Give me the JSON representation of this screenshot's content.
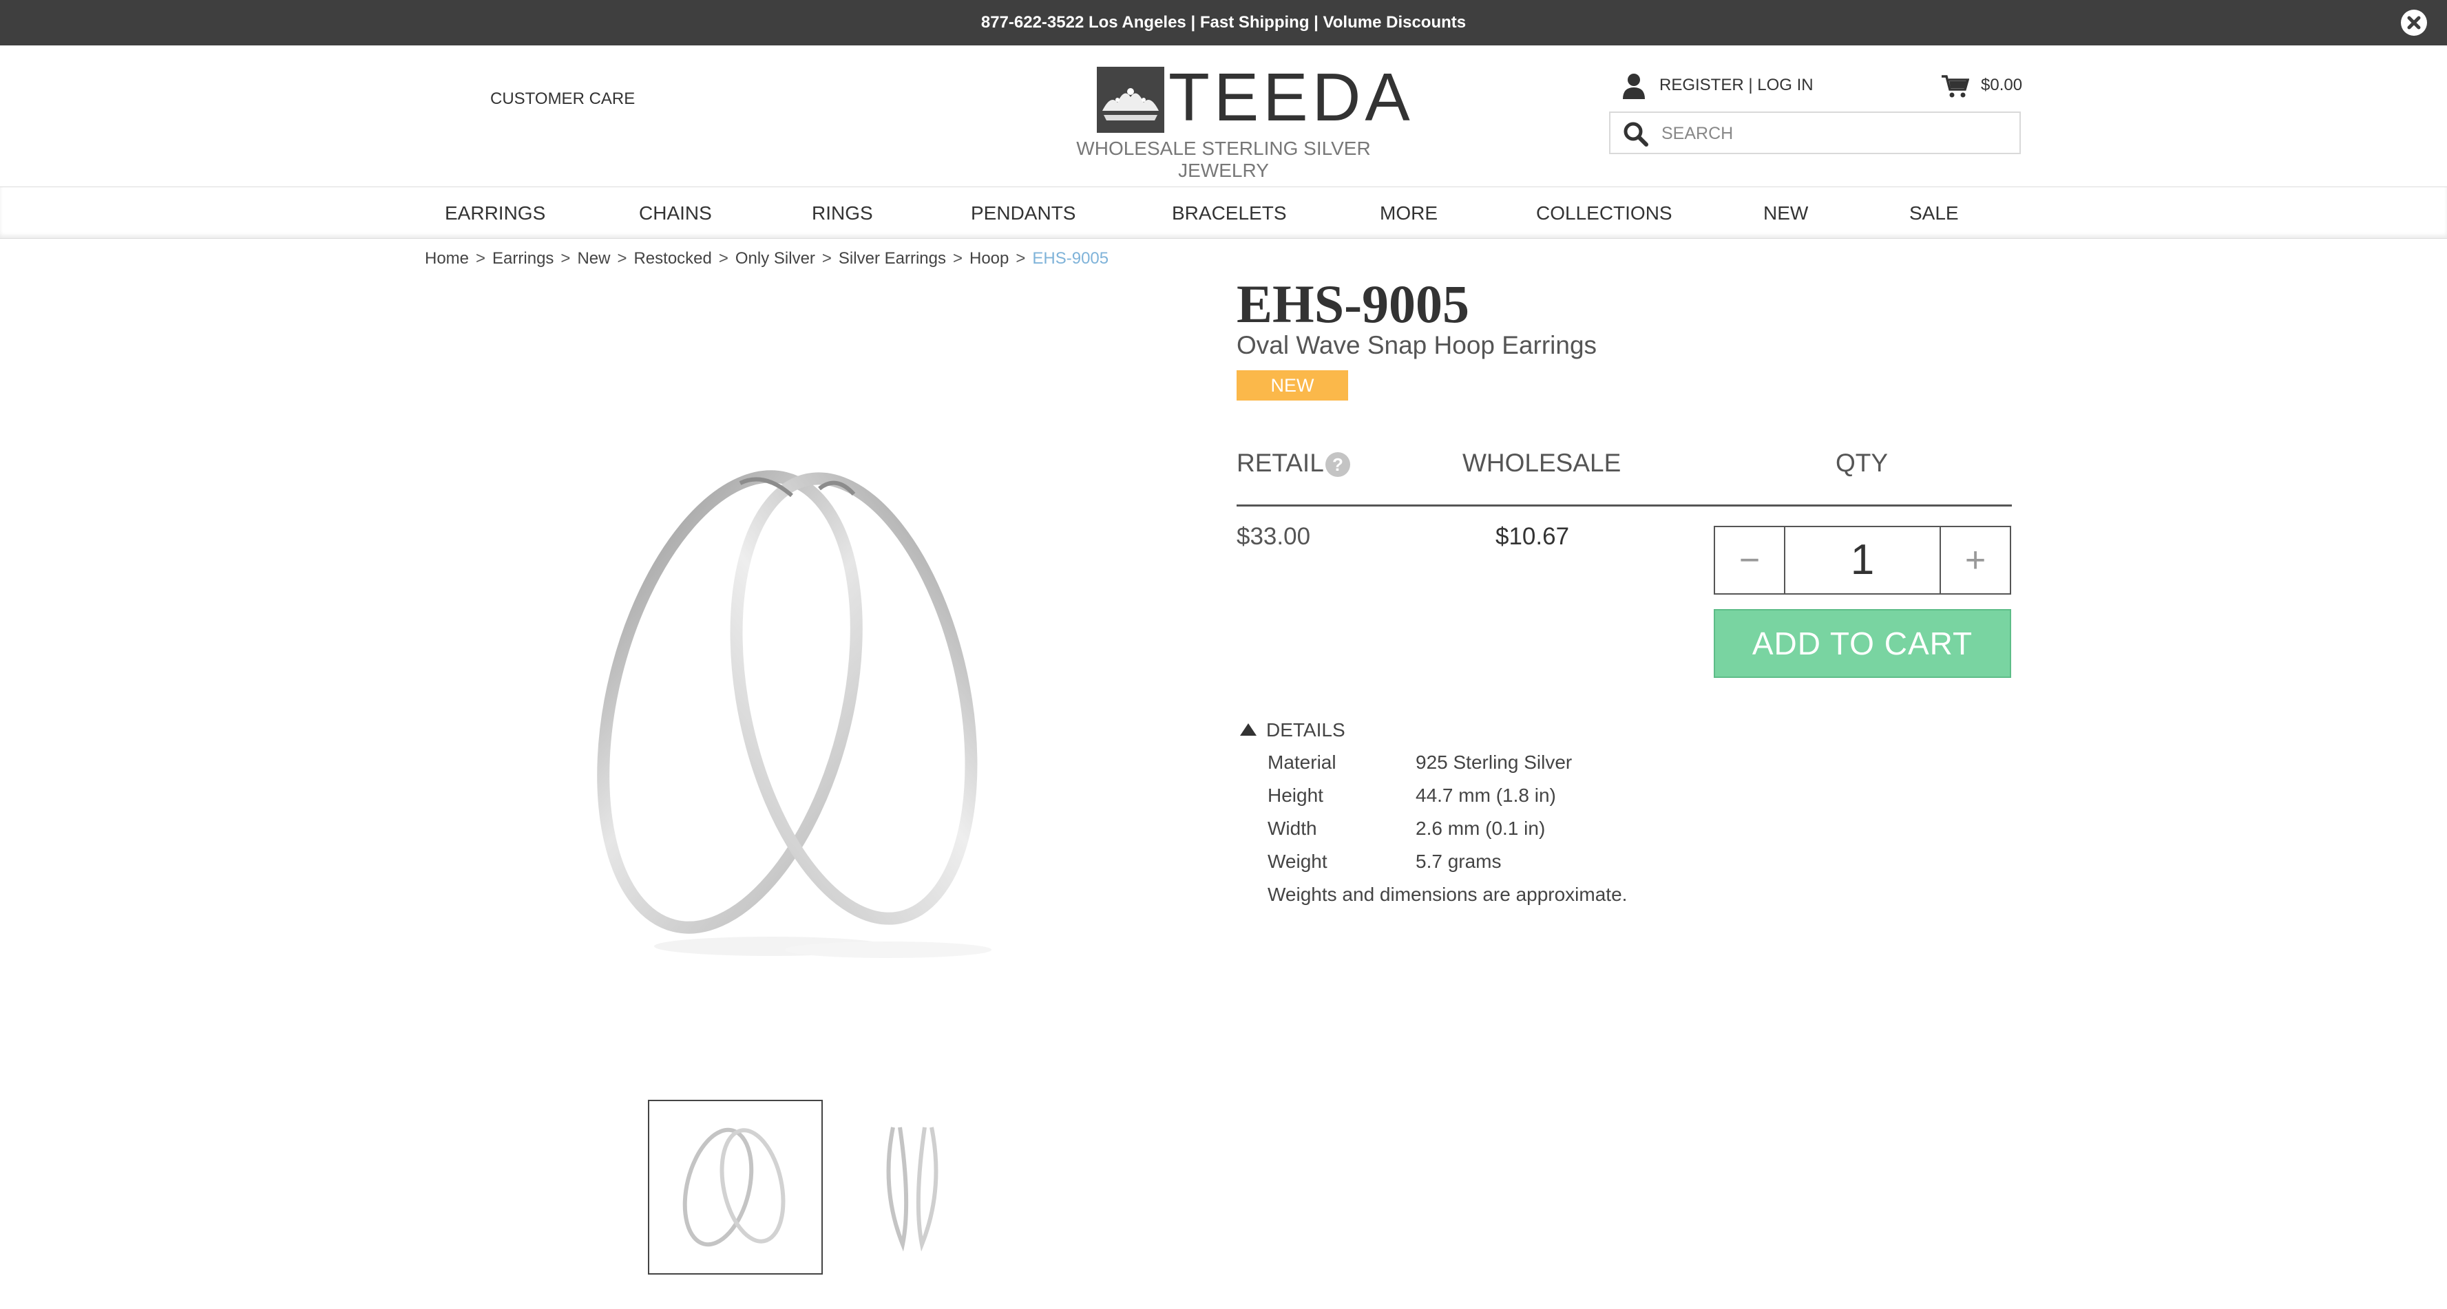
{
  "topbar": {
    "message": "877-622-3522 Los Angeles | Fast Shipping | Volume Discounts"
  },
  "header": {
    "customer_care": "CUSTOMER CARE",
    "logo_text": "TEEDA",
    "tagline": "WHOLESALE STERLING SILVER JEWELRY",
    "account_link": "REGISTER | LOG IN",
    "cart_total": "$0.00",
    "search_placeholder": "SEARCH"
  },
  "nav": {
    "items": [
      "EARRINGS",
      "CHAINS",
      "RINGS",
      "PENDANTS",
      "BRACELETS",
      "MORE",
      "COLLECTIONS",
      "NEW",
      "SALE"
    ]
  },
  "breadcrumb": {
    "items": [
      "Home",
      "Earrings",
      "New",
      "Restocked",
      "Only Silver",
      "Silver Earrings",
      "Hoop"
    ],
    "current": "EHS-9005",
    "separator": ">"
  },
  "product": {
    "sku": "EHS-9005",
    "name": "Oval Wave Snap Hoop Earrings",
    "badge": "NEW",
    "retail_label": "RETAIL",
    "help_glyph": "?",
    "wholesale_label": "WHOLESALE",
    "qty_label": "QTY",
    "retail_price": "$33.00",
    "wholesale_price": "$10.67",
    "quantity": "1",
    "minus_glyph": "−",
    "plus_glyph": "+",
    "add_to_cart": "ADD TO CART",
    "details_label": "DETAILS",
    "details": [
      {
        "label": "Material",
        "value": "925 Sterling Silver"
      },
      {
        "label": "Height",
        "value": "44.7 mm (1.8 in)"
      },
      {
        "label": "Width",
        "value": "2.6 mm (0.1 in)"
      },
      {
        "label": "Weight",
        "value": "5.7 grams"
      }
    ],
    "details_note": "Weights and dimensions are approximate."
  },
  "colors": {
    "topbar_bg": "#3f3f3f",
    "badge": "#fbb84a",
    "add_to_cart": "#79d4a1",
    "breadcrumb_current": "#7fb3d9"
  }
}
